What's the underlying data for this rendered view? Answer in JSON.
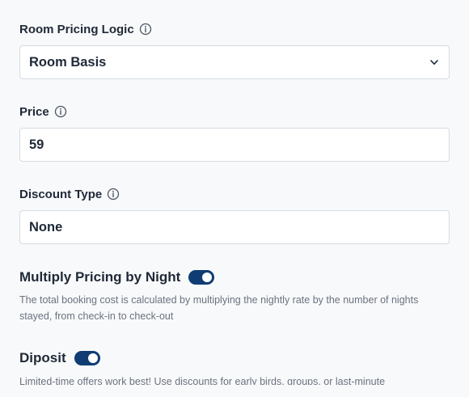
{
  "room_pricing": {
    "label": "Room Pricing Logic",
    "value": "Room Basis"
  },
  "price": {
    "label": "Price",
    "value": "59"
  },
  "discount_type": {
    "label": "Discount Type",
    "value": "None"
  },
  "multiply_pricing": {
    "label": "Multiply Pricing by Night",
    "enabled": true,
    "description": "The total booking cost is calculated by multiplying the nightly rate by the number of nights stayed, from check-in to check-out"
  },
  "deposit": {
    "label": "Diposit",
    "enabled": true,
    "description": "Limited-time offers work best! Use discounts for early birds, groups, or last-minute"
  },
  "colors": {
    "toggle_on": "#0f3d73",
    "background": "#f8f9fa"
  }
}
